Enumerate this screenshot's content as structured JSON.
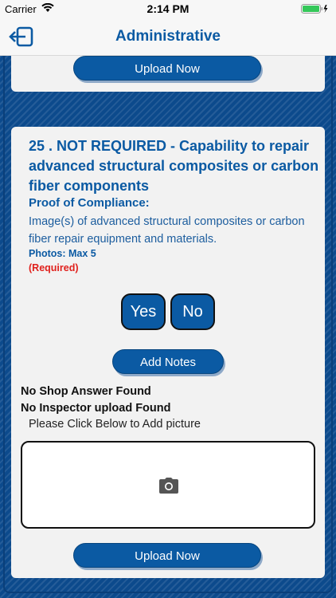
{
  "status_bar": {
    "carrier": "Carrier",
    "time": "2:14 PM"
  },
  "nav": {
    "title": "Administrative",
    "back_icon": "exit-icon"
  },
  "top_card": {
    "upload_label": "Upload Now"
  },
  "question": {
    "title": "25 . NOT REQUIRED - Capability to repair advanced structural composites or carbon fiber components",
    "proof_label": "Proof of Compliance:",
    "proof_desc": "Image(s) of advanced structural composites or carbon fiber repair equipment and materials.",
    "photos_max": "Photos: Max 5",
    "required": "(Required)",
    "yes_label": "Yes",
    "no_label": "No",
    "add_notes_label": "Add Notes",
    "shop_answer": "No Shop Answer Found",
    "inspector_upload": "No Inspector upload Found",
    "hint": "Please Click Below to Add picture",
    "upload_label": "Upload Now"
  },
  "colors": {
    "accent": "#0b5aa3",
    "required": "#e0201c",
    "background": "#0c4a8c"
  }
}
